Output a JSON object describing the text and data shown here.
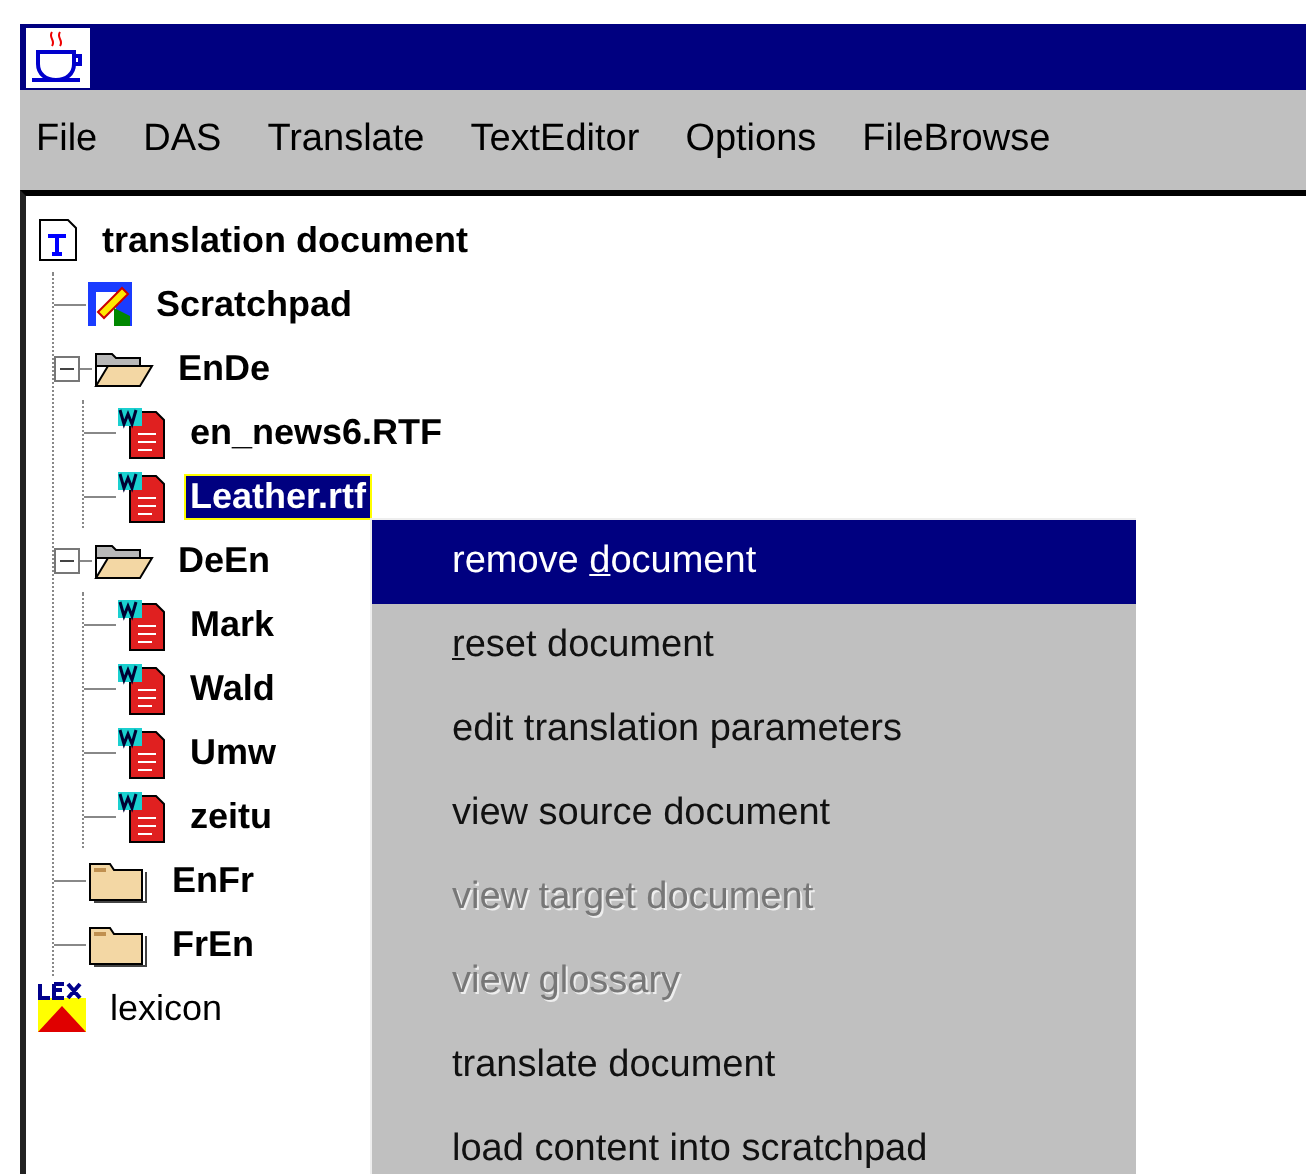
{
  "menu_bar": [
    "File",
    "DAS",
    "Translate",
    "TextEditor",
    "Options",
    "FileBrowse"
  ],
  "tree": [
    {
      "label": "translation document",
      "kind": "root",
      "selected": false,
      "children": [
        {
          "label": "Scratchpad",
          "kind": "scratchpad",
          "selected": false
        },
        {
          "label": "EnDe",
          "kind": "folder",
          "expanded": true,
          "selected": false,
          "children": [
            {
              "label": "en_news6.RTF",
              "kind": "document",
              "selected": false
            },
            {
              "label": "Leather.rtf",
              "kind": "document",
              "selected": true
            }
          ]
        },
        {
          "label": "DeEn",
          "kind": "folder",
          "expanded": true,
          "selected": false,
          "children": [
            {
              "label": "Mark",
              "kind": "document",
              "selected": false
            },
            {
              "label": "Wald",
              "kind": "document",
              "selected": false
            },
            {
              "label": "Umw",
              "kind": "document",
              "selected": false
            },
            {
              "label": "zeitu",
              "kind": "document",
              "selected": false
            }
          ]
        },
        {
          "label": "EnFr",
          "kind": "folder",
          "expanded": false,
          "selected": false
        },
        {
          "label": "FrEn",
          "kind": "folder",
          "expanded": false,
          "selected": false
        }
      ]
    },
    {
      "label": "lexicon",
      "kind": "lexicon",
      "selected": false
    }
  ],
  "context_menu": [
    {
      "before": "remove ",
      "mnemonic": "d",
      "after": "ocument",
      "selected": true,
      "disabled": false
    },
    {
      "mnemonic": "r",
      "after": "eset document",
      "selected": false,
      "disabled": false
    },
    {
      "label": "edit translation parameters",
      "selected": false,
      "disabled": false
    },
    {
      "label": "view source document",
      "selected": false,
      "disabled": false
    },
    {
      "label": "view target document",
      "selected": false,
      "disabled": true
    },
    {
      "label": "view glossary",
      "selected": false,
      "disabled": true
    },
    {
      "label": "translate document",
      "selected": false,
      "disabled": false
    },
    {
      "label": "load content into scratchpad",
      "selected": false,
      "disabled": false
    }
  ]
}
